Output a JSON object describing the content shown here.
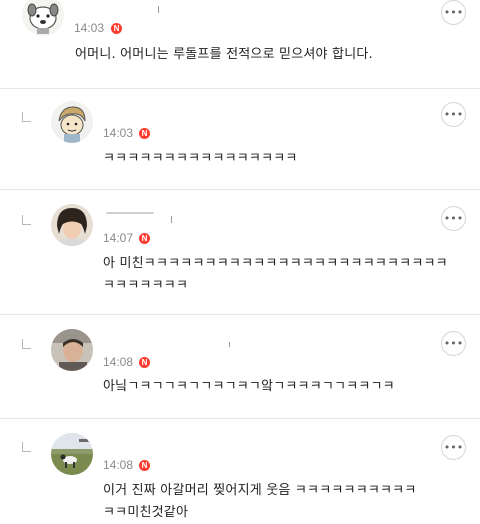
{
  "comments": [
    {
      "time": "14:03",
      "badge": "N",
      "lines": [
        "어머니. 어머니는 루돌프를 전적으로 믿으셔야 합니다."
      ],
      "is_reply": false
    },
    {
      "time": "14:03",
      "badge": "N",
      "lines": [
        "ㅋㅋㅋㅋㅋㅋㅋㅋㅋㅋㅋㅋㅋㅋㅋㅋ"
      ],
      "is_reply": true
    },
    {
      "time": "14:07",
      "badge": "N",
      "lines": [
        "아 미친ㅋㅋㅋㅋㅋㅋㅋㅋㅋㅋㅋㅋㅋㅋㅋㅋㅋㅋㅋㅋㅋㅋㅋㅋㅋ",
        "ㅋㅋㅋㅋㅋㅋㅋ"
      ],
      "is_reply": true
    },
    {
      "time": "14:08",
      "badge": "N",
      "lines": [
        "아닠ㄱㅋㄱㄱㅋㄱㄱㅋㄱㅋㄱ앜ㄱㅋㅋㅋㄱㄱㅋㅋㄱㅋ"
      ],
      "is_reply": true
    },
    {
      "time": "14:08",
      "badge": "N",
      "lines": [
        "이거 진짜 아갈머리 찢어지게 웃음 ㅋㅋㅋㅋㅋㅋㅋㅋㅋㅋ",
        "ㅋㅋ미친것같아"
      ],
      "is_reply": true
    }
  ],
  "more_icon": "ellipsis-icon",
  "reply_icon": "reply-corner-icon",
  "colors": {
    "badge": "#ff3b30",
    "time": "#8a8a8a",
    "divider": "#e8e8e8"
  }
}
